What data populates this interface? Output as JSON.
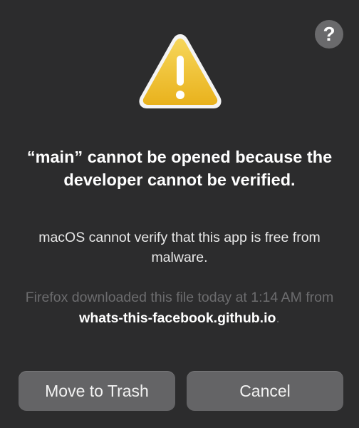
{
  "dialog": {
    "help_label": "?",
    "icon": "warning-triangle-icon",
    "title": "“main” cannot be opened because the developer cannot be verified.",
    "message": "macOS cannot verify that this app is free from malware.",
    "info_prefix": "Firefox downloaded this file today at 1:14 AM from ",
    "info_source": "whats-this-facebook.github.io",
    "info_suffix": ".",
    "buttons": {
      "move_to_trash": "Move to Trash",
      "cancel": "Cancel"
    }
  },
  "colors": {
    "background": "#2c2c2d",
    "button": "#646466",
    "warning_fill": "#f2c22b",
    "muted_text": "#6c6c6e"
  }
}
